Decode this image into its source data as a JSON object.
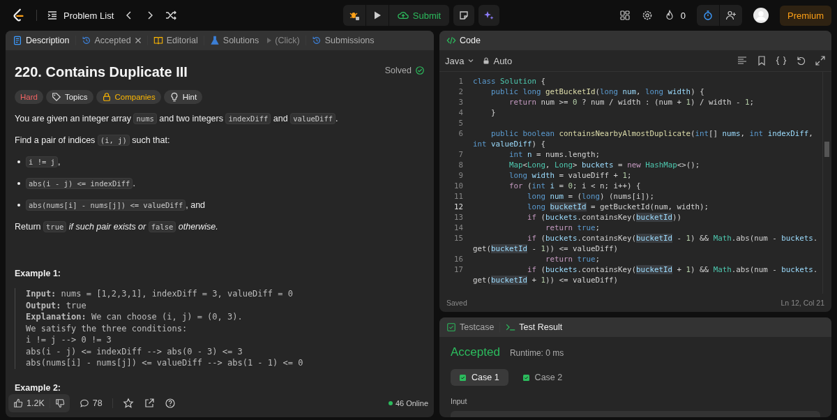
{
  "topbar": {
    "problem_list": "Problem List",
    "submit": "Submit",
    "streak": "0",
    "premium": "Premium"
  },
  "description_panel": {
    "tabs": [
      {
        "label": "Description",
        "kind": "doc",
        "selected": true,
        "closable": false
      },
      {
        "label": "Accepted",
        "kind": "history",
        "selected": false,
        "closable": true
      },
      {
        "label": "Editorial",
        "kind": "book",
        "selected": false,
        "closable": false
      },
      {
        "label": "Solutions",
        "kind": "flask",
        "selected": false,
        "closable": false
      },
      {
        "label": "(Click)",
        "kind": "play",
        "selected": false,
        "closable": false
      },
      {
        "label": "Submissions",
        "kind": "history",
        "selected": false,
        "closable": false
      }
    ],
    "title": "220. Contains Duplicate III",
    "status": "Solved",
    "tags": [
      {
        "label": "Hard",
        "kind": "difficulty"
      },
      {
        "label": "Topics",
        "kind": "tag"
      },
      {
        "label": "Companies",
        "kind": "lock"
      },
      {
        "label": "Hint",
        "kind": "bulb"
      }
    ],
    "paragraphs": [
      {
        "kind": "para",
        "segments": [
          {
            "kind": "text",
            "text": "You are given an integer array "
          },
          {
            "kind": "code",
            "text": "nums"
          },
          {
            "kind": "text",
            "text": " and two integers "
          },
          {
            "kind": "code",
            "text": "indexDiff"
          },
          {
            "kind": "text",
            "text": " and "
          },
          {
            "kind": "code",
            "text": "valueDiff"
          },
          {
            "kind": "text",
            "text": "."
          }
        ]
      },
      {
        "kind": "para",
        "segments": [
          {
            "kind": "text",
            "text": "Find a pair of indices "
          },
          {
            "kind": "code",
            "text": "(i, j)"
          },
          {
            "kind": "text",
            "text": " such that:"
          }
        ]
      },
      {
        "kind": "bullet",
        "segments": [
          {
            "kind": "code",
            "text": "i != j"
          },
          {
            "kind": "text",
            "text": ","
          }
        ]
      },
      {
        "kind": "bullet",
        "segments": [
          {
            "kind": "code",
            "text": "abs(i - j) <= indexDiff"
          },
          {
            "kind": "text",
            "text": "."
          }
        ]
      },
      {
        "kind": "bullet",
        "segments": [
          {
            "kind": "code",
            "text": "abs(nums[i] - nums[j]) <= valueDiff"
          },
          {
            "kind": "text",
            "text": ", and"
          }
        ]
      },
      {
        "kind": "para",
        "segments": [
          {
            "kind": "text",
            "text": "Return "
          },
          {
            "kind": "code",
            "text": "true"
          },
          {
            "kind": "em",
            "text": " if such pair exists or "
          },
          {
            "kind": "code",
            "text": "false"
          },
          {
            "kind": "em",
            "text": " otherwise."
          }
        ]
      }
    ],
    "examples": [
      {
        "title": "Example 1:",
        "lines": [
          "**Input:** nums = [1,2,3,1], indexDiff = 3, valueDiff = 0",
          "**Output:** true",
          "**Explanation:** We can choose (i, j) = (0, 3).",
          "We satisfy the three conditions:",
          "i != j --> 0 != 3",
          "abs(i - j) <= indexDiff --> abs(0 - 3) <= 3",
          "abs(nums[i] - nums[j]) <= valueDiff --> abs(1 - 1) <= 0"
        ]
      },
      {
        "title": "Example 2:"
      }
    ],
    "footer": {
      "likes": "1.2K",
      "comments": "78",
      "online": "46 Online"
    }
  },
  "code_panel": {
    "title": "Code",
    "language": "Java",
    "mode": "Auto",
    "lines": [
      {
        "number": "1",
        "current": false,
        "segments": [
          {
            "kind": "kw",
            "text": "class "
          },
          {
            "kind": "type",
            "text": "Solution"
          },
          {
            "kind": "p",
            "text": " {"
          }
        ]
      },
      {
        "number": "2",
        "current": false,
        "segments": [
          {
            "kind": "kw",
            "text": "    public long "
          },
          {
            "kind": "fn",
            "text": "getBucketId"
          },
          {
            "kind": "p",
            "text": "("
          },
          {
            "kind": "kw",
            "text": "long "
          },
          {
            "kind": "var",
            "text": "num"
          },
          {
            "kind": "p",
            "text": ", "
          },
          {
            "kind": "kw",
            "text": "long "
          },
          {
            "kind": "var",
            "text": "width"
          },
          {
            "kind": "p",
            "text": ") {"
          }
        ]
      },
      {
        "number": "3",
        "current": false,
        "segments": [
          {
            "kind": "ctl",
            "text": "        return"
          },
          {
            "kind": "p",
            "text": " num >= "
          },
          {
            "kind": "num",
            "text": "0"
          },
          {
            "kind": "p",
            "text": " ? num / width : (num + "
          },
          {
            "kind": "num",
            "text": "1"
          },
          {
            "kind": "p",
            "text": ") / width - "
          },
          {
            "kind": "num",
            "text": "1"
          },
          {
            "kind": "p",
            "text": ";"
          }
        ]
      },
      {
        "number": "4",
        "current": false,
        "segments": [
          {
            "kind": "p",
            "text": "    }"
          }
        ]
      },
      {
        "number": "5",
        "current": false
      },
      {
        "number": "6",
        "current": false,
        "segments": [
          {
            "kind": "kw",
            "text": "    public boolean "
          },
          {
            "kind": "fn",
            "text": "containsNearbyAlmostDuplicate"
          },
          {
            "kind": "p",
            "text": "("
          },
          {
            "kind": "kw",
            "text": "int"
          },
          {
            "kind": "p",
            "text": "[] "
          },
          {
            "kind": "var",
            "text": "nums"
          },
          {
            "kind": "p",
            "text": ", "
          },
          {
            "kind": "kw",
            "text": "int "
          },
          {
            "kind": "var",
            "text": "indexDiff"
          },
          {
            "kind": "p",
            "text": ","
          }
        ]
      },
      {
        "segments": [
          {
            "kind": "kw",
            "text": "int "
          },
          {
            "kind": "var",
            "text": "valueDiff"
          },
          {
            "kind": "p",
            "text": ") {"
          }
        ]
      },
      {
        "number": "7",
        "current": false,
        "segments": [
          {
            "kind": "kw",
            "text": "        int "
          },
          {
            "kind": "var",
            "text": "n"
          },
          {
            "kind": "p",
            "text": " = nums.length;"
          }
        ]
      },
      {
        "number": "8",
        "current": false,
        "segments": [
          {
            "kind": "type",
            "text": "        Map"
          },
          {
            "kind": "p",
            "text": "<"
          },
          {
            "kind": "type",
            "text": "Long"
          },
          {
            "kind": "p",
            "text": ", "
          },
          {
            "kind": "type",
            "text": "Long"
          },
          {
            "kind": "p",
            "text": "> "
          },
          {
            "kind": "var",
            "text": "buckets"
          },
          {
            "kind": "p",
            "text": " = "
          },
          {
            "kind": "ctl",
            "text": "new "
          },
          {
            "kind": "type",
            "text": "HashMap"
          },
          {
            "kind": "p",
            "text": "<>();"
          }
        ]
      },
      {
        "number": "9",
        "current": false,
        "segments": [
          {
            "kind": "kw",
            "text": "        long "
          },
          {
            "kind": "var",
            "text": "width"
          },
          {
            "kind": "p",
            "text": " = valueDiff + "
          },
          {
            "kind": "num",
            "text": "1"
          },
          {
            "kind": "p",
            "text": ";"
          }
        ]
      },
      {
        "number": "10",
        "current": false,
        "segments": [
          {
            "kind": "ctl",
            "text": "        for"
          },
          {
            "kind": "p",
            "text": " ("
          },
          {
            "kind": "kw",
            "text": "int "
          },
          {
            "kind": "var",
            "text": "i"
          },
          {
            "kind": "p",
            "text": " = "
          },
          {
            "kind": "num",
            "text": "0"
          },
          {
            "kind": "p",
            "text": "; i < n; i++) {"
          }
        ]
      },
      {
        "number": "11",
        "current": false,
        "segments": [
          {
            "kind": "kw",
            "text": "            long "
          },
          {
            "kind": "var",
            "text": "num"
          },
          {
            "kind": "p",
            "text": " = ("
          },
          {
            "kind": "kw",
            "text": "long"
          },
          {
            "kind": "p",
            "text": ") (nums[i]);"
          }
        ]
      },
      {
        "number": "12",
        "current": true,
        "segments": [
          {
            "kind": "kw",
            "text": "            long "
          },
          {
            "kind": "hl",
            "text": "bucketId"
          },
          {
            "kind": "p",
            "text": " = getBucketId(num, width);"
          }
        ]
      },
      {
        "number": "13",
        "current": false,
        "segments": [
          {
            "kind": "ctl",
            "text": "            if"
          },
          {
            "kind": "p",
            "text": " ("
          },
          {
            "kind": "var",
            "text": "buckets"
          },
          {
            "kind": "p",
            "text": ".containsKey("
          },
          {
            "kind": "hl",
            "text": "bucketId"
          },
          {
            "kind": "p",
            "text": "))"
          }
        ]
      },
      {
        "number": "14",
        "current": false,
        "segments": [
          {
            "kind": "ctl",
            "text": "                return "
          },
          {
            "kind": "kw",
            "text": "true"
          },
          {
            "kind": "p",
            "text": ";"
          }
        ]
      },
      {
        "number": "15",
        "current": false,
        "segments": [
          {
            "kind": "ctl",
            "text": "            if"
          },
          {
            "kind": "p",
            "text": " ("
          },
          {
            "kind": "var",
            "text": "buckets"
          },
          {
            "kind": "p",
            "text": ".containsKey("
          },
          {
            "kind": "hl",
            "text": "bucketId"
          },
          {
            "kind": "p",
            "text": " - "
          },
          {
            "kind": "num",
            "text": "1"
          },
          {
            "kind": "p",
            "text": ") && "
          },
          {
            "kind": "type",
            "text": "Math"
          },
          {
            "kind": "p",
            "text": ".abs(num - "
          },
          {
            "kind": "var",
            "text": "buckets"
          },
          {
            "kind": "p",
            "text": "."
          }
        ]
      },
      {
        "segments": [
          {
            "kind": "p",
            "text": "get("
          },
          {
            "kind": "hl",
            "text": "bucketId"
          },
          {
            "kind": "p",
            "text": " - "
          },
          {
            "kind": "num",
            "text": "1"
          },
          {
            "kind": "p",
            "text": ")) <= valueDiff)"
          }
        ]
      },
      {
        "number": "16",
        "current": false,
        "segments": [
          {
            "kind": "ctl",
            "text": "                return "
          },
          {
            "kind": "kw",
            "text": "true"
          },
          {
            "kind": "p",
            "text": ";"
          }
        ]
      },
      {
        "number": "17",
        "current": false,
        "segments": [
          {
            "kind": "ctl",
            "text": "            if"
          },
          {
            "kind": "p",
            "text": " ("
          },
          {
            "kind": "var",
            "text": "buckets"
          },
          {
            "kind": "p",
            "text": ".containsKey("
          },
          {
            "kind": "hl",
            "text": "bucketId"
          },
          {
            "kind": "p",
            "text": " + "
          },
          {
            "kind": "num",
            "text": "1"
          },
          {
            "kind": "p",
            "text": ") && "
          },
          {
            "kind": "type",
            "text": "Math"
          },
          {
            "kind": "p",
            "text": ".abs(num - "
          },
          {
            "kind": "var",
            "text": "buckets"
          },
          {
            "kind": "p",
            "text": "."
          }
        ]
      },
      {
        "segments": [
          {
            "kind": "p",
            "text": "get("
          },
          {
            "kind": "hl",
            "text": "bucketId"
          },
          {
            "kind": "p",
            "text": " + "
          },
          {
            "kind": "num",
            "text": "1"
          },
          {
            "kind": "p",
            "text": ")) <= valueDiff)"
          }
        ]
      }
    ],
    "save_status": "Saved",
    "cursor": "Ln 12, Col 21"
  },
  "result_panel": {
    "tabs": [
      {
        "label": "Testcase",
        "kind": "check",
        "selected": false
      },
      {
        "label": "Test Result",
        "kind": "terminal",
        "selected": true
      }
    ],
    "verdict": "Accepted",
    "runtime": "Runtime: 0 ms",
    "cases": [
      {
        "label": "Case 1",
        "passed": true,
        "selected": true
      },
      {
        "label": "Case 2",
        "passed": true,
        "selected": false
      }
    ],
    "input_label": "Input"
  }
}
